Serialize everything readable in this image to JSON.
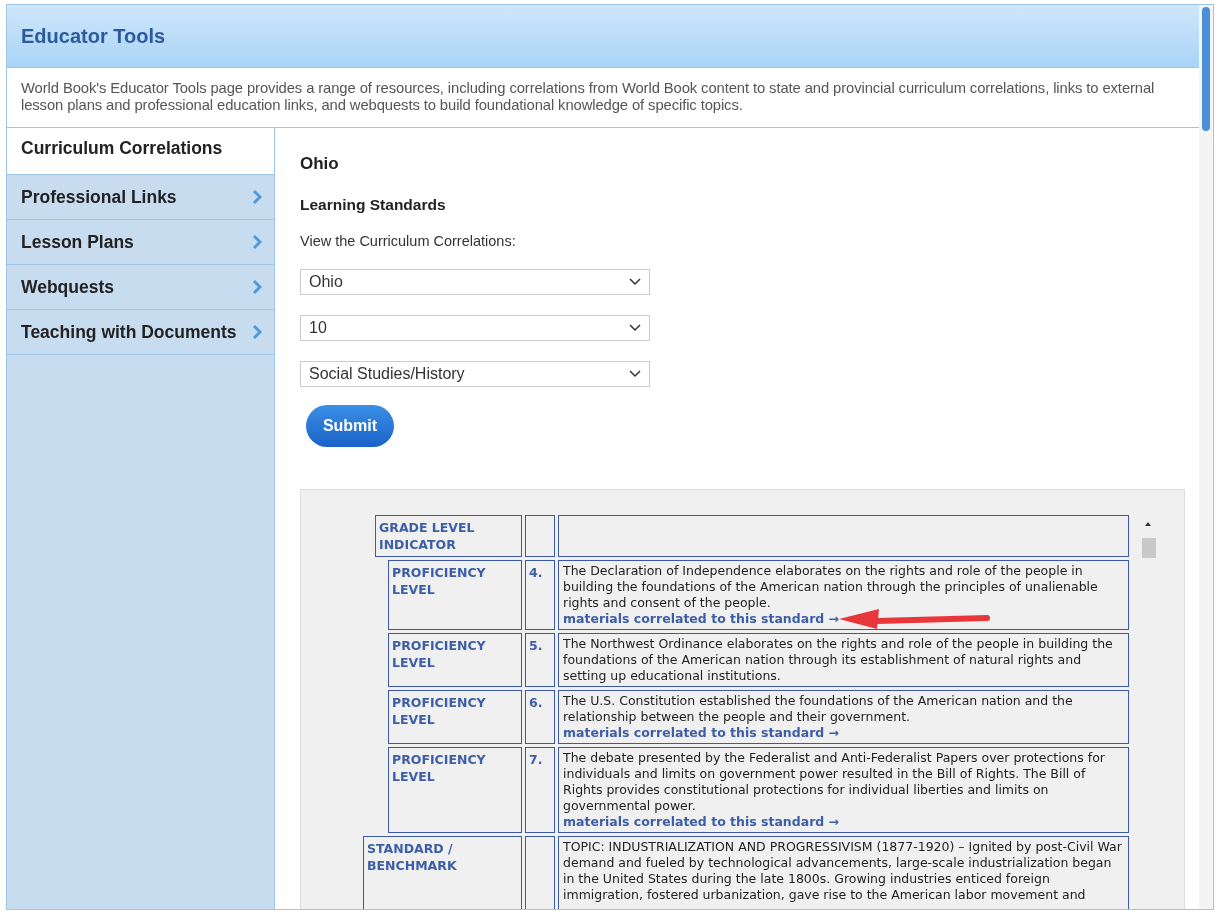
{
  "header": {
    "title": "Educator Tools"
  },
  "intro": "World Book's Educator Tools page provides a range of resources, including correlations from World Book content to state and provincial curriculum correlations, links to external lesson plans and professional education links, and webquests to build foundational knowledge of specific topics.",
  "sidebar": {
    "items": [
      {
        "label": "Curriculum Correlations",
        "selected": true
      },
      {
        "label": "Professional Links",
        "selected": false
      },
      {
        "label": "Lesson Plans",
        "selected": false
      },
      {
        "label": "Webquests",
        "selected": false
      },
      {
        "label": "Teaching with Documents",
        "selected": false
      }
    ]
  },
  "content": {
    "title": "Ohio",
    "subtitle": "Learning Standards",
    "prompt": "View the Curriculum Correlations:",
    "selects": [
      {
        "value": "Ohio"
      },
      {
        "value": "10"
      },
      {
        "value": "Social Studies/History"
      }
    ],
    "submit": "Submit",
    "rows": [
      {
        "kind": "indicator",
        "label": "GRADE LEVEL INDICATOR",
        "number": "",
        "text": ""
      },
      {
        "kind": "proficiency",
        "label": "PROFICIENCY LEVEL",
        "number": "4.",
        "text": "The Declaration of Independence elaborates on the rights and role of the people in building the foundations of the American nation through the principles of unalienable rights and consent of the people.",
        "link": "materials correlated to this standard →",
        "annotated": true
      },
      {
        "kind": "proficiency",
        "label": "PROFICIENCY LEVEL",
        "number": "5.",
        "text": "The Northwest Ordinance elaborates on the rights and role of the people in building the foundations of the American nation through its establishment of natural rights and setting up educational institutions."
      },
      {
        "kind": "proficiency",
        "label": "PROFICIENCY LEVEL",
        "number": "6.",
        "text": "The U.S. Constitution established the foundations of the American nation and the relationship between the people and their government.",
        "link": "materials correlated to this standard →"
      },
      {
        "kind": "proficiency",
        "label": "PROFICIENCY LEVEL",
        "number": "7.",
        "text": "The debate presented by the Federalist and Anti-Federalist Papers over protections for individuals and limits on government power resulted in the Bill of Rights. The Bill of Rights provides constitutional protections for individual liberties and limits on governmental power.",
        "link": "materials correlated to this standard →"
      },
      {
        "kind": "standard",
        "label": "STANDARD / BENCHMARK",
        "number": "",
        "text": "TOPIC: INDUSTRIALIZATION AND PROGRESSIVISM (1877-1920) – Ignited by post-Civil War demand and fueled by technological advancements, large-scale industrialization began in the United States during the late 1800s. Growing industries enticed foreign immigration, fostered urbanization, gave rise to the American labor movement and"
      }
    ]
  }
}
